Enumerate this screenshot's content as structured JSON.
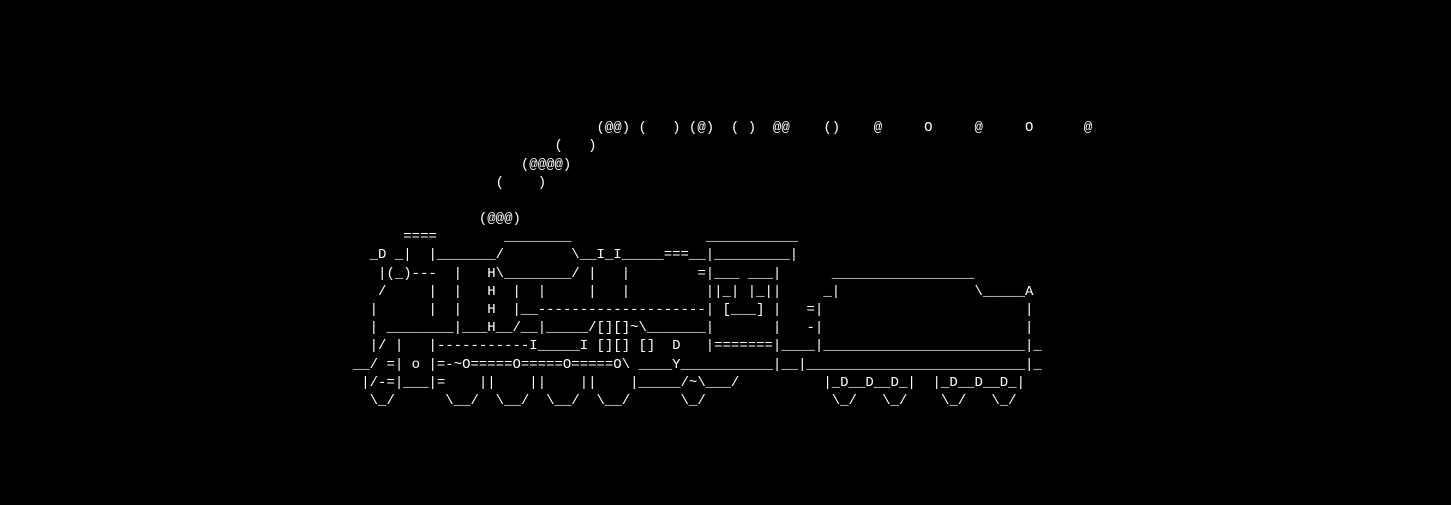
{
  "ascii_art": {
    "lines": [
      "",
      "",
      "                                                                       (@@) (   ) (@)  ( )  @@    ()    @     O     @     O      @",
      "                                                                  (   )",
      "                                                              (@@@@)",
      "                                                           (    )",
      "",
      "                                                         (@@@)",
      "                                                ====        ________                ___________",
      "                                            _D _|  |_______/        \\__I_I_____===__|_________|",
      "                                             |(_)---  |   H\\________/ |   |        =|___ ___|      _________________",
      "                                             /     |  |   H  |  |     |   |         ||_| |_||     _|                \\_____A",
      "                                            |      |  |   H  |__--------------------| [___] |   =|                        |",
      "                                            | ________|___H__/__|_____/[][]~\\_______|       |   -|                        |",
      "                                            |/ |   |-----------I_____I [][] []  D   |=======|____|________________________|_",
      "                                          __/ =| o |=-~O=====O=====O=====O\\ ____Y___________|__|__________________________|_",
      "                                           |/-=|___|=    ||    ||    ||    |_____/~\\___/          |_D__D__D_|  |_D__D__D_|",
      "                                            \\_/      \\__/  \\__/  \\__/  \\__/      \\_/               \\_/   \\_/    \\_/   \\_/"
    ]
  }
}
